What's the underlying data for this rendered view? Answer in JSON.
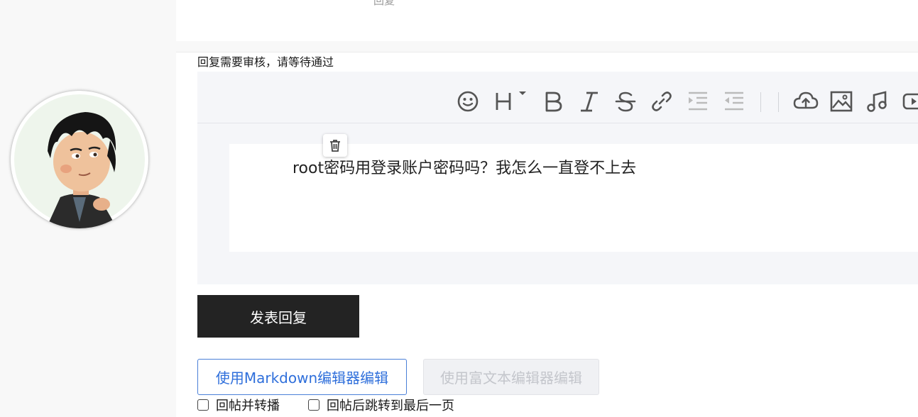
{
  "previous_post": {
    "reply_link": "回复"
  },
  "notice": "回复需要审核，请等待通过",
  "toolbar": {
    "icons": [
      "emoji-icon",
      "heading-icon",
      "bold-icon",
      "italic-icon",
      "strikethrough-icon",
      "link-icon",
      "indent-icon",
      "outdent-icon",
      "upload-icon",
      "image-icon",
      "music-icon",
      "video-icon"
    ]
  },
  "editor": {
    "content": "root密码用登录账户密码吗？我怎么一直登不上去"
  },
  "actions": {
    "submit_label": "发表回复",
    "markdown_label": "使用Markdown编辑器编辑",
    "richtext_label": "使用富文本编辑器编辑"
  },
  "options": {
    "repost_label": "回帖并转播",
    "jump_label": "回帖后跳转到最后一页"
  },
  "colors": {
    "accent": "#2f6fdb",
    "button_dark": "#232323",
    "editor_bg": "#f5f6f9",
    "icon": "#555555"
  }
}
